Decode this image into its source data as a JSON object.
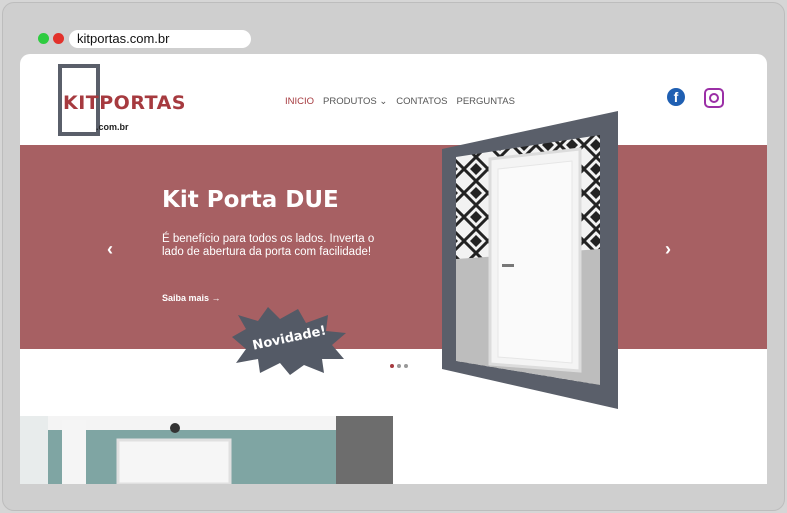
{
  "browser": {
    "url": "kitportas.com.br"
  },
  "header": {
    "logo_main": "KITPORTAS",
    "logo_sub": ".com.br",
    "nav": [
      {
        "label": "INICIO",
        "active": true
      },
      {
        "label": "PRODUTOS ⌄",
        "active": false
      },
      {
        "label": "CONTATOS",
        "active": false
      },
      {
        "label": "PERGUNTAS",
        "active": false
      }
    ],
    "social": [
      "facebook-icon",
      "instagram-icon"
    ]
  },
  "hero": {
    "title": "Kit Porta DUE",
    "description": "É benefício para todos os lados. Inverta o lado de abertura da porta com facilidade!",
    "link": "Saiba mais →",
    "badge": "Novidade!",
    "prev": "‹",
    "next": "›",
    "slides_total": 3,
    "slide_active": 1
  },
  "colors": {
    "brand": "#a63a3f",
    "hero_bg": "#a76063",
    "frame": "#5a5f6a"
  }
}
